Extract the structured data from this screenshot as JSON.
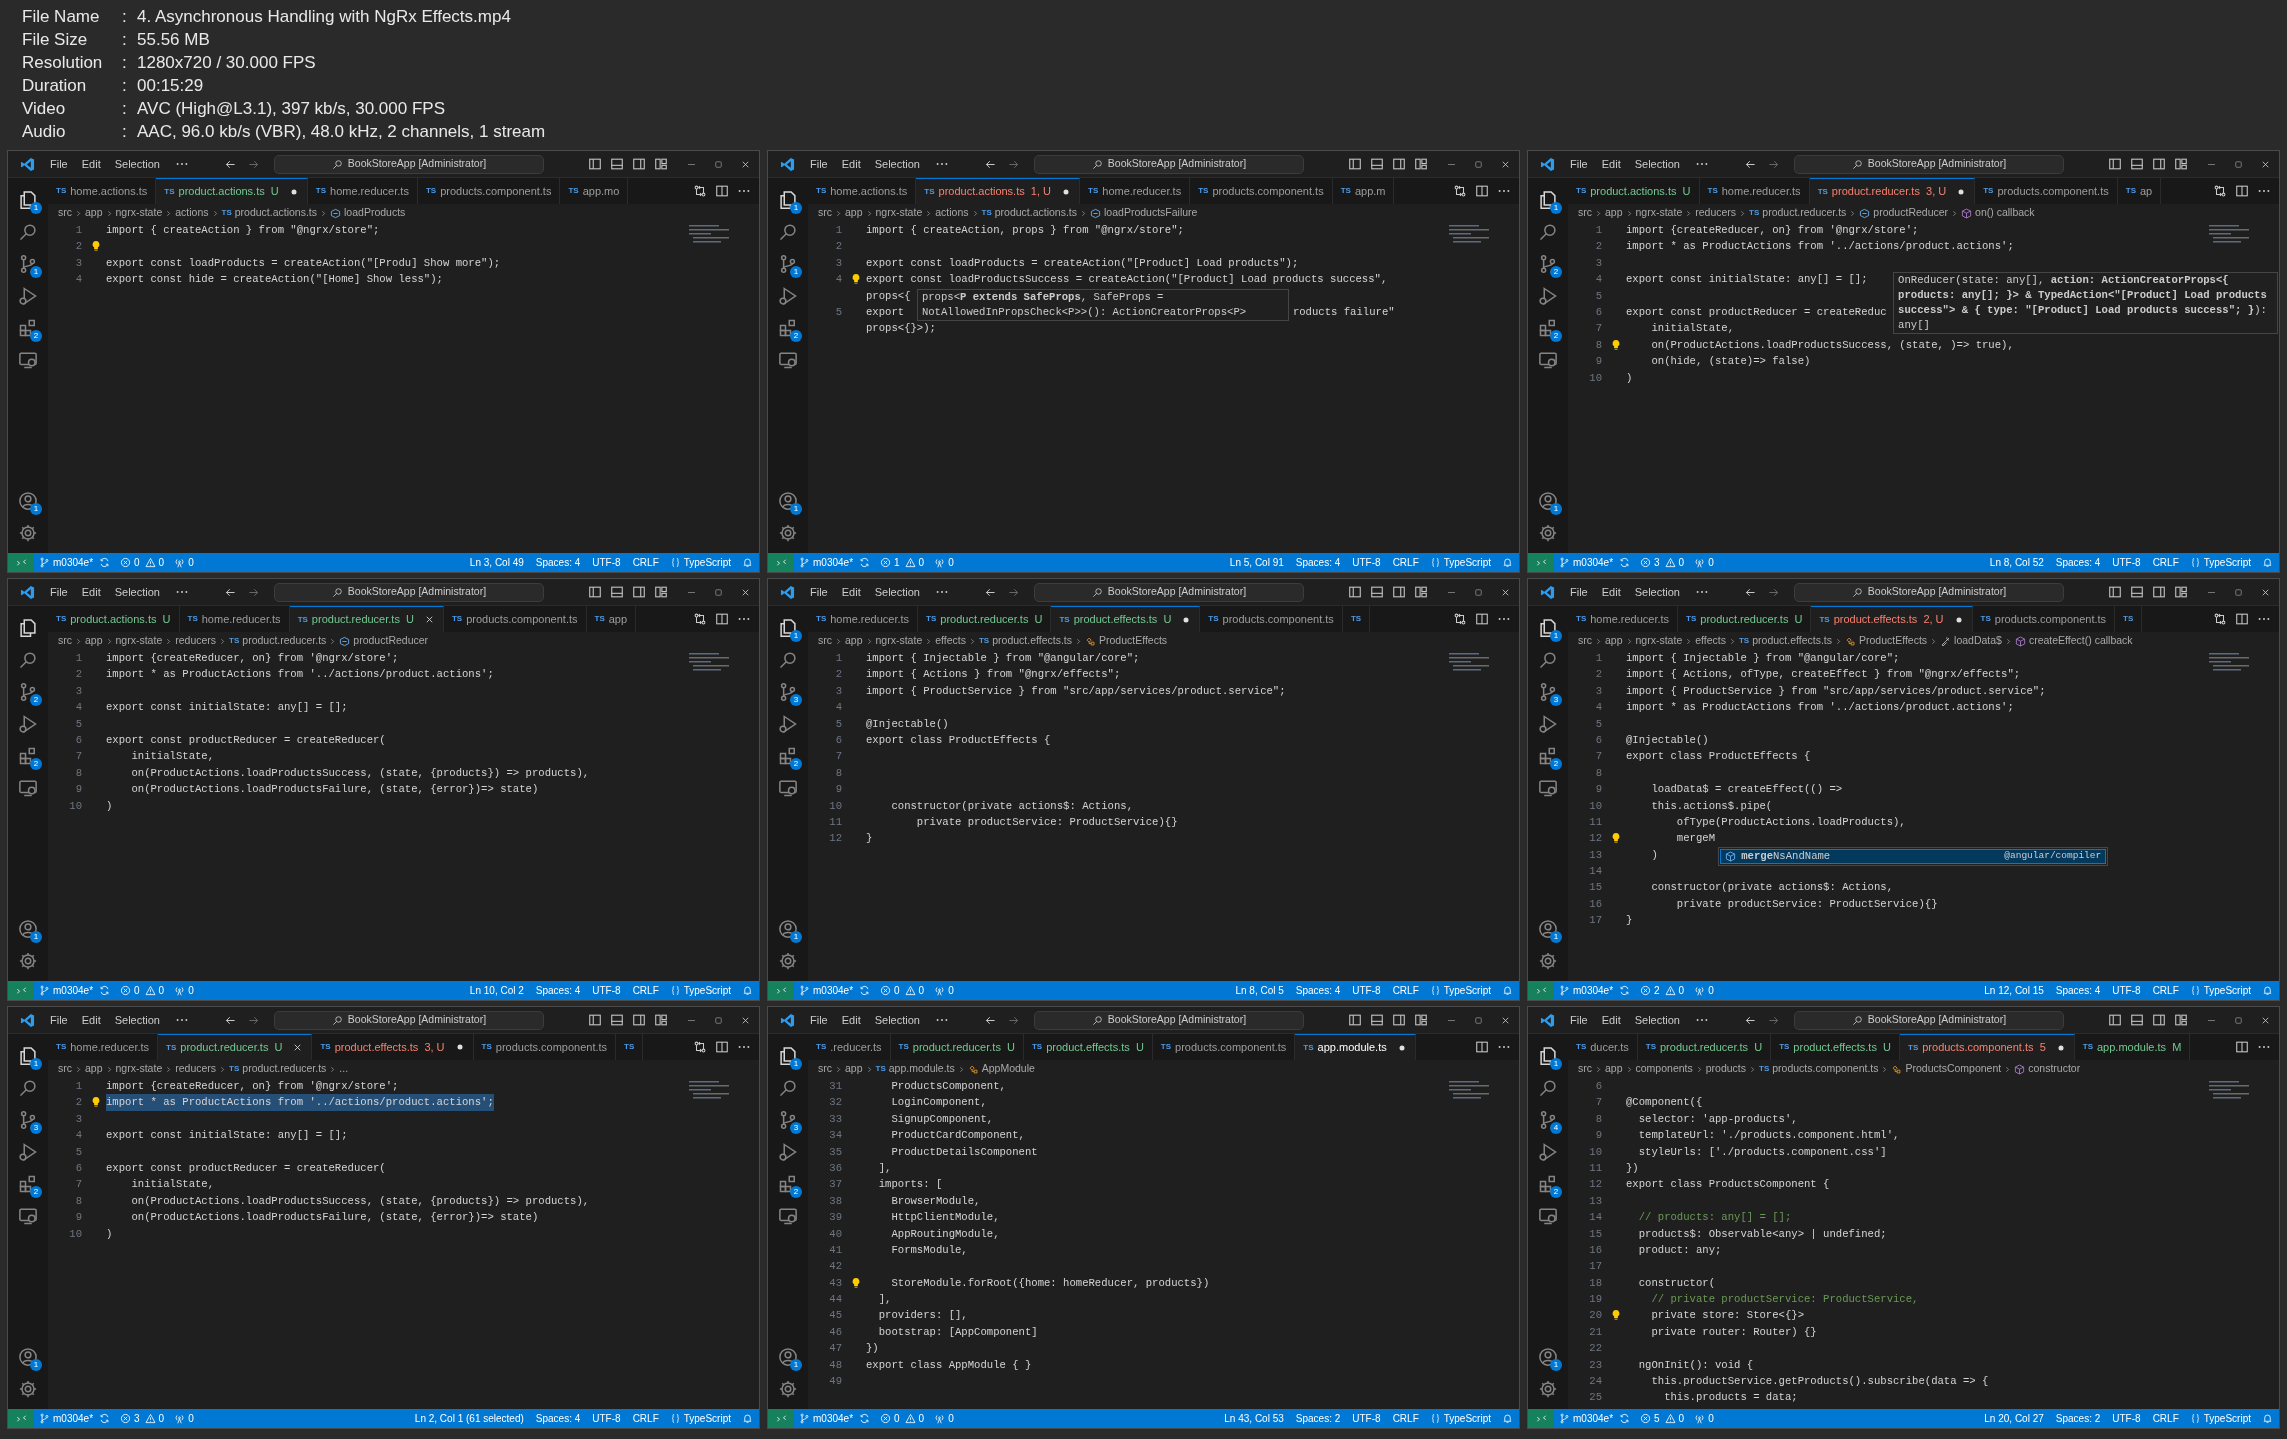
{
  "info": [
    {
      "label": "File Name",
      "colon": ":",
      "value": "4. Asynchronous Handling with NgRx Effects.mp4"
    },
    {
      "label": "File Size",
      "colon": ":",
      "value": "55.56 MB"
    },
    {
      "label": "Resolution",
      "colon": ":",
      "value": "1280x720 / 30.000 FPS"
    },
    {
      "label": "Duration",
      "colon": ":",
      "value": "00:15:29"
    },
    {
      "label": "Video",
      "colon": ":",
      "value": "AVC (High@L3.1), 397 kb/s, 30.000 FPS"
    },
    {
      "label": "Audio",
      "colon": ":",
      "value": "AAC, 96.0 kb/s (VBR), 48.0 kHz, 2 channels, 1 stream"
    }
  ],
  "panels": [
    {
      "menu": [
        "File",
        "Edit",
        "Selection"
      ],
      "title": "BookStoreApp [Administrator]",
      "badges": {
        "explorer": "1",
        "source_control": "1",
        "extensions": "2",
        "accounts": "1"
      },
      "compare_action": true,
      "tabs": [
        {
          "icon_text": "TS",
          "label": "home.actions.ts",
          "selected": false,
          "modified": false,
          "close_button": false
        },
        {
          "icon_text": "TS",
          "label": "product.actions.ts",
          "status": "U",
          "color": "#73c991",
          "selected": true,
          "modified": true,
          "close_button": false
        },
        {
          "icon_text": "TS",
          "label": "home.reducer.ts",
          "selected": false,
          "modified": false,
          "close_button": false
        },
        {
          "icon_text": "TS",
          "label": "products.component.ts",
          "selected": false,
          "modified": false,
          "close_button": false
        },
        {
          "icon_text": "TS",
          "label": "app.mo",
          "selected": false,
          "modified": false,
          "close_button": false
        }
      ],
      "breadcrumb": [
        {
          "kind": "folder",
          "label": "src"
        },
        {
          "kind": "folder",
          "label": "app"
        },
        {
          "kind": "folder",
          "label": "ngrx-state"
        },
        {
          "kind": "folder",
          "label": "actions"
        },
        {
          "kind": "file",
          "icon_text": "TS",
          "label": "product.actions.ts"
        },
        {
          "kind": "variable",
          "label": "loadProducts"
        }
      ],
      "lines": [
        {
          "n": "1",
          "text": "import { createAction } from \"@ngrx/store\";"
        },
        {
          "n": "2",
          "bulb": true
        },
        {
          "n": "3",
          "text": "export const loadProducts = createAction(\"[Produ] Show more\");"
        },
        {
          "n": "4",
          "text": "export const hide = createAction(\"[Home] Show less\");"
        }
      ],
      "status": {
        "branch": "m0304e*",
        "errors": "0",
        "warnings": "0",
        "ports": "0",
        "position": "Ln 3, Col 49",
        "indent": "Spaces: 4",
        "encoding": "UTF-8",
        "eol": "CRLF",
        "language": "TypeScript"
      }
    },
    {
      "menu": [
        "File",
        "Edit",
        "Selection"
      ],
      "title": "BookStoreApp [Administrator]",
      "badges": {
        "explorer": "1",
        "source_control": "1",
        "extensions": "2",
        "accounts": "1"
      },
      "compare_action": true,
      "tabs": [
        {
          "icon_text": "TS",
          "label": "home.actions.ts",
          "selected": false,
          "modified": false,
          "close_button": false
        },
        {
          "icon_text": "TS",
          "label": "product.actions.ts",
          "status": "1, U",
          "color": "#f88070",
          "selected": true,
          "modified": true,
          "close_button": false
        },
        {
          "icon_text": "TS",
          "label": "home.reducer.ts",
          "selected": false,
          "modified": false,
          "close_button": false
        },
        {
          "icon_text": "TS",
          "label": "products.component.ts",
          "selected": false,
          "modified": false,
          "close_button": false
        },
        {
          "icon_text": "TS",
          "label": "app.m",
          "selected": false,
          "modified": false,
          "close_button": false
        }
      ],
      "breadcrumb": [
        {
          "kind": "folder",
          "label": "src"
        },
        {
          "kind": "folder",
          "label": "app"
        },
        {
          "kind": "folder",
          "label": "ngrx-state"
        },
        {
          "kind": "folder",
          "label": "actions"
        },
        {
          "kind": "file",
          "icon_text": "TS",
          "label": "product.actions.ts"
        },
        {
          "kind": "variable",
          "label": "loadProductsFailure"
        }
      ],
      "lines": [
        {
          "n": "1",
          "text": "import { createAction, props } from \"@ngrx/store\";"
        },
        {
          "n": "2"
        },
        {
          "n": "3",
          "text": "export const loadProducts = createAction(\"[Product] Load products\");"
        },
        {
          "n": "4",
          "bulb": true,
          "text": "export const loadProductsSuccess = createAction(\"[Product] Load products success\","
        },
        {
          "text": "props<{",
          "popup": {
            "kind": "hover",
            "text": "props<**P extends SafeProps**, SafeProps = NotAllowedInPropsCheck<P>>(): ActionCreatorProps<P>"
          }
        },
        {
          "n": "5",
          "text": "export",
          "tail": "roducts failure\""
        },
        {
          "text": "props<{}>);"
        }
      ],
      "status": {
        "branch": "m0304e*",
        "errors": "1",
        "warnings": "0",
        "ports": "0",
        "position": "Ln 5, Col 91",
        "indent": "Spaces: 4",
        "encoding": "UTF-8",
        "eol": "CRLF",
        "language": "TypeScript"
      }
    },
    {
      "menu": [
        "File",
        "Edit",
        "Selection"
      ],
      "title": "BookStoreApp [Administrator]",
      "badges": {
        "explorer": "1",
        "source_control": "2",
        "extensions": "2",
        "accounts": "1"
      },
      "compare_action": true,
      "tabs": [
        {
          "icon_text": "TS",
          "label": "product.actions.ts",
          "status": "U",
          "color": "#73c991",
          "selected": false,
          "modified": false,
          "close_button": false
        },
        {
          "icon_text": "TS",
          "label": "home.reducer.ts",
          "selected": false,
          "modified": false,
          "close_button": false
        },
        {
          "icon_text": "TS",
          "label": "product.reducer.ts",
          "status": "3, U",
          "color": "#f88070",
          "selected": true,
          "modified": true,
          "close_button": false
        },
        {
          "icon_text": "TS",
          "label": "products.component.ts",
          "selected": false,
          "modified": false,
          "close_button": false
        },
        {
          "icon_text": "TS",
          "label": "ap",
          "selected": false,
          "modified": false,
          "close_button": false
        }
      ],
      "breadcrumb": [
        {
          "kind": "folder",
          "label": "src"
        },
        {
          "kind": "folder",
          "label": "app"
        },
        {
          "kind": "folder",
          "label": "ngrx-state"
        },
        {
          "kind": "folder",
          "label": "reducers"
        },
        {
          "kind": "file",
          "icon_text": "TS",
          "label": "product.reducer.ts"
        },
        {
          "kind": "variable",
          "label": "productReducer"
        },
        {
          "kind": "method",
          "label": "on() callback"
        }
      ],
      "lines": [
        {
          "n": "1",
          "text": "import {createReducer, on} from '@ngrx/store';"
        },
        {
          "n": "2",
          "text": "import * as ProductActions from '../actions/product.actions';"
        },
        {
          "n": "3"
        },
        {
          "n": "4",
          "text": "export const initialState: any[] = [];",
          "popup": {
            "kind": "hover",
            "text": "OnReducer(state: any[], **action: ActionCreatorProps<{ products: any[]; }> & TypedAction<\"[Product] Load products success\"> & { type: \"[Product] Load products success\"; }**): any[]"
          }
        },
        {
          "n": "5"
        },
        {
          "n": "6",
          "text": "export const productReducer = createReduc"
        },
        {
          "n": "7",
          "text": "    initialState,"
        },
        {
          "n": "8",
          "bulb": true,
          "text": "    on(ProductActions.loadProductsSuccess, (state, )=> true),"
        },
        {
          "n": "9",
          "text": "    on(hide, (state)=> false)"
        },
        {
          "n": "10",
          "text": ")"
        }
      ],
      "status": {
        "branch": "m0304e*",
        "errors": "3",
        "warnings": "0",
        "ports": "0",
        "position": "Ln 8, Col 52",
        "indent": "Spaces: 4",
        "encoding": "UTF-8",
        "eol": "CRLF",
        "language": "TypeScript"
      }
    },
    {
      "menu": [
        "File",
        "Edit",
        "Selection"
      ],
      "title": "BookStoreApp [Administrator]",
      "badges": {
        "source_control": "2",
        "extensions": "2",
        "accounts": "1"
      },
      "compare_action": true,
      "tabs": [
        {
          "icon_text": "TS",
          "label": "product.actions.ts",
          "status": "U",
          "color": "#73c991",
          "selected": false,
          "modified": false,
          "close_button": false
        },
        {
          "icon_text": "TS",
          "label": "home.reducer.ts",
          "selected": false,
          "modified": false,
          "close_button": false
        },
        {
          "icon_text": "TS",
          "label": "product.reducer.ts",
          "status": "U",
          "color": "#73c991",
          "selected": true,
          "modified": false,
          "close_button": true
        },
        {
          "icon_text": "TS",
          "label": "products.component.ts",
          "selected": false,
          "modified": false,
          "close_button": false
        },
        {
          "icon_text": "TS",
          "label": "app",
          "selected": false,
          "modified": false,
          "close_button": false
        }
      ],
      "breadcrumb": [
        {
          "kind": "folder",
          "label": "src"
        },
        {
          "kind": "folder",
          "label": "app"
        },
        {
          "kind": "folder",
          "label": "ngrx-state"
        },
        {
          "kind": "folder",
          "label": "reducers"
        },
        {
          "kind": "file",
          "icon_text": "TS",
          "label": "product.reducer.ts"
        },
        {
          "kind": "variable",
          "label": "productReducer"
        }
      ],
      "lines": [
        {
          "n": "1",
          "text": "import {createReducer, on} from '@ngrx/store';"
        },
        {
          "n": "2",
          "text": "import * as ProductActions from '../actions/product.actions';"
        },
        {
          "n": "3"
        },
        {
          "n": "4",
          "text": "export const initialState: any[] = [];"
        },
        {
          "n": "5"
        },
        {
          "n": "6",
          "text": "export const productReducer = createReducer("
        },
        {
          "n": "7",
          "text": "    initialState,"
        },
        {
          "n": "8",
          "text": "    on(ProductActions.loadProductsSuccess, (state, {products}) => products),"
        },
        {
          "n": "9",
          "text": "    on(ProductActions.loadProductsFailure, (state, {error})=> state)"
        },
        {
          "n": "10",
          "text": ")"
        }
      ],
      "status": {
        "branch": "m0304e*",
        "errors": "0",
        "warnings": "0",
        "ports": "0",
        "position": "Ln 10, Col 2",
        "indent": "Spaces: 4",
        "encoding": "UTF-8",
        "eol": "CRLF",
        "language": "TypeScript"
      }
    },
    {
      "menu": [
        "File",
        "Edit",
        "Selection"
      ],
      "title": "BookStoreApp [Administrator]",
      "badges": {
        "explorer": "1",
        "source_control": "3",
        "extensions": "2",
        "accounts": "1"
      },
      "compare_action": true,
      "tabs": [
        {
          "icon_text": "TS",
          "label": "home.reducer.ts",
          "selected": false,
          "modified": false,
          "close_button": false
        },
        {
          "icon_text": "TS",
          "label": "product.reducer.ts",
          "status": "U",
          "color": "#73c991",
          "selected": false,
          "modified": false,
          "close_button": false
        },
        {
          "icon_text": "TS",
          "label": "product.effects.ts",
          "status": "U",
          "color": "#73c991",
          "selected": true,
          "modified": true,
          "close_button": false
        },
        {
          "icon_text": "TS",
          "label": "products.component.ts",
          "selected": false,
          "modified": false,
          "close_button": false
        },
        {
          "icon_text": "TS",
          "selected": false,
          "modified": false,
          "close_button": false
        }
      ],
      "breadcrumb": [
        {
          "kind": "folder",
          "label": "src"
        },
        {
          "kind": "folder",
          "label": "app"
        },
        {
          "kind": "folder",
          "label": "ngrx-state"
        },
        {
          "kind": "folder",
          "label": "effects"
        },
        {
          "kind": "file",
          "icon_text": "TS",
          "label": "product.effects.ts"
        },
        {
          "kind": "class",
          "label": "ProductEffects"
        }
      ],
      "lines": [
        {
          "n": "1",
          "text": "import { Injectable } from \"@angular/core\";"
        },
        {
          "n": "2",
          "text": "import { Actions } from \"@ngrx/effects\";"
        },
        {
          "n": "3",
          "text": "import { ProductService } from \"src/app/services/product.service\";"
        },
        {
          "n": "4"
        },
        {
          "n": "5",
          "text": "@Injectable()"
        },
        {
          "n": "6",
          "text": "export class ProductEffects {"
        },
        {
          "n": "7"
        },
        {
          "n": "8"
        },
        {
          "n": "9"
        },
        {
          "n": "10",
          "text": "    constructor(private actions$: Actions,"
        },
        {
          "n": "11",
          "text": "        private productService: ProductService){}"
        },
        {
          "n": "12",
          "text": "}"
        }
      ],
      "status": {
        "branch": "m0304e*",
        "errors": "0",
        "warnings": "0",
        "ports": "0",
        "position": "Ln 8, Col 5",
        "indent": "Spaces: 4",
        "encoding": "UTF-8",
        "eol": "CRLF",
        "language": "TypeScript"
      }
    },
    {
      "menu": [
        "File",
        "Edit",
        "Selection"
      ],
      "title": "BookStoreApp [Administrator]",
      "badges": {
        "explorer": "1",
        "source_control": "3",
        "extensions": "2",
        "accounts": "1"
      },
      "compare_action": true,
      "tabs": [
        {
          "icon_text": "TS",
          "label": "home.reducer.ts",
          "selected": false,
          "modified": false,
          "close_button": false
        },
        {
          "icon_text": "TS",
          "label": "product.reducer.ts",
          "status": "U",
          "color": "#73c991",
          "selected": false,
          "modified": false,
          "close_button": false
        },
        {
          "icon_text": "TS",
          "label": "product.effects.ts",
          "status": "2, U",
          "color": "#f88070",
          "selected": true,
          "modified": true,
          "close_button": false
        },
        {
          "icon_text": "TS",
          "label": "products.component.ts",
          "selected": false,
          "modified": false,
          "close_button": false
        },
        {
          "icon_text": "TS",
          "selected": false,
          "modified": false,
          "close_button": false
        }
      ],
      "breadcrumb": [
        {
          "kind": "folder",
          "label": "src"
        },
        {
          "kind": "folder",
          "label": "app"
        },
        {
          "kind": "folder",
          "label": "ngrx-state"
        },
        {
          "kind": "folder",
          "label": "effects"
        },
        {
          "kind": "file",
          "icon_text": "TS",
          "label": "product.effects.ts"
        },
        {
          "kind": "class",
          "label": "ProductEffects"
        },
        {
          "kind": "property",
          "label": "loadData$"
        },
        {
          "kind": "method",
          "label": "createEffect() callback"
        }
      ],
      "lines": [
        {
          "n": "1",
          "text": "import { Injectable } from \"@angular/core\";"
        },
        {
          "n": "2",
          "text": "import { Actions, ofType, createEffect } from \"@ngrx/effects\";"
        },
        {
          "n": "3",
          "text": "import { ProductService } from \"src/app/services/product.service\";"
        },
        {
          "n": "4",
          "text": "import * as ProductActions from '../actions/product.actions';"
        },
        {
          "n": "5"
        },
        {
          "n": "6",
          "text": "@Injectable()"
        },
        {
          "n": "7",
          "text": "export class ProductEffects {"
        },
        {
          "n": "8"
        },
        {
          "n": "9",
          "text": "    loadData$ = createEffect(() =>"
        },
        {
          "n": "10",
          "text": "    this.actions$.pipe("
        },
        {
          "n": "11",
          "text": "        ofType(ProductActions.loadProducts),"
        },
        {
          "n": "12",
          "bulb": true,
          "text": "        mergeM",
          "popup": {
            "kind": "suggest",
            "text": "**merge**NsAndName",
            "detail": "@angular/compiler"
          }
        },
        {
          "n": "13",
          "text": "    )"
        },
        {
          "n": "14"
        },
        {
          "n": "15",
          "text": "    constructor(private actions$: Actions,"
        },
        {
          "n": "16",
          "text": "        private productService: ProductService){}"
        },
        {
          "n": "17",
          "text": "}"
        }
      ],
      "status": {
        "branch": "m0304e*",
        "errors": "2",
        "warnings": "0",
        "ports": "0",
        "position": "Ln 12, Col 15",
        "indent": "Spaces: 4",
        "encoding": "UTF-8",
        "eol": "CRLF",
        "language": "TypeScript"
      }
    },
    {
      "menu": [
        "File",
        "Edit",
        "Selection"
      ],
      "title": "BookStoreApp [Administrator]",
      "badges": {
        "explorer": "1",
        "source_control": "3",
        "extensions": "2",
        "accounts": "1"
      },
      "compare_action": true,
      "tabs": [
        {
          "icon_text": "TS",
          "label": "home.reducer.ts",
          "selected": false,
          "modified": false,
          "close_button": false
        },
        {
          "icon_text": "TS",
          "label": "product.reducer.ts",
          "status": "U",
          "color": "#73c991",
          "selected": true,
          "modified": false,
          "close_button": true
        },
        {
          "icon_text": "TS",
          "label": "product.effects.ts",
          "status": "3, U",
          "color": "#f88070",
          "selected": false,
          "modified": true,
          "close_button": false
        },
        {
          "icon_text": "TS",
          "label": "products.component.ts",
          "selected": false,
          "modified": false,
          "close_button": false
        },
        {
          "icon_text": "TS",
          "selected": false,
          "modified": false,
          "close_button": false
        }
      ],
      "breadcrumb": [
        {
          "kind": "folder",
          "label": "src"
        },
        {
          "kind": "folder",
          "label": "app"
        },
        {
          "kind": "folder",
          "label": "ngrx-state"
        },
        {
          "kind": "folder",
          "label": "reducers"
        },
        {
          "kind": "file",
          "icon_text": "TS",
          "label": "product.reducer.ts"
        },
        {
          "kind": "more",
          "label": "..."
        }
      ],
      "lines": [
        {
          "n": "1",
          "text": "import {createReducer, on} from '@ngrx/store';"
        },
        {
          "n": "2",
          "bulb": true,
          "selected": true,
          "text": "import * as ProductActions from '../actions/product.actions';"
        },
        {
          "n": "3"
        },
        {
          "n": "4",
          "text": "export const initialState: any[] = [];"
        },
        {
          "n": "5"
        },
        {
          "n": "6",
          "text": "export const productReducer = createReducer("
        },
        {
          "n": "7",
          "text": "    initialState,"
        },
        {
          "n": "8",
          "text": "    on(ProductActions.loadProductsSuccess, (state, {products}) => products),"
        },
        {
          "n": "9",
          "text": "    on(ProductActions.loadProductsFailure, (state, {error})=> state)"
        },
        {
          "n": "10",
          "text": ")"
        }
      ],
      "status": {
        "branch": "m0304e*",
        "errors": "3",
        "warnings": "0",
        "ports": "0",
        "position": "Ln 2, Col 1 (61 selected)",
        "indent": "Spaces: 4",
        "encoding": "UTF-8",
        "eol": "CRLF",
        "language": "TypeScript"
      }
    },
    {
      "menu": [
        "File",
        "Edit",
        "Selection"
      ],
      "title": "BookStoreApp [Administrator]",
      "badges": {
        "explorer": "1",
        "source_control": "3",
        "extensions": "2",
        "accounts": "1"
      },
      "compare_action": false,
      "tabs": [
        {
          "icon_text": "TS",
          "label": ".reducer.ts",
          "selected": false,
          "modified": false,
          "close_button": false
        },
        {
          "icon_text": "TS",
          "label": "product.reducer.ts",
          "status": "U",
          "color": "#73c991",
          "selected": false,
          "modified": false,
          "close_button": false
        },
        {
          "icon_text": "TS",
          "label": "product.effects.ts",
          "status": "U",
          "color": "#73c991",
          "selected": false,
          "modified": false,
          "close_button": false
        },
        {
          "icon_text": "TS",
          "label": "products.component.ts",
          "selected": false,
          "modified": false,
          "close_button": false
        },
        {
          "icon_text": "TS",
          "label": "app.module.ts",
          "selected": true,
          "modified": true,
          "close_button": false
        }
      ],
      "breadcrumb": [
        {
          "kind": "folder",
          "label": "src"
        },
        {
          "kind": "folder",
          "label": "app"
        },
        {
          "kind": "file",
          "icon_text": "TS",
          "label": "app.module.ts"
        },
        {
          "kind": "class",
          "label": "AppModule"
        }
      ],
      "lines": [
        {
          "n": "31",
          "text": "    ProductsComponent,"
        },
        {
          "n": "32",
          "text": "    LoginComponent,"
        },
        {
          "n": "33",
          "text": "    SignupComponent,"
        },
        {
          "n": "34",
          "text": "    ProductCardComponent,"
        },
        {
          "n": "35",
          "text": "    ProductDetailsComponent"
        },
        {
          "n": "36",
          "text": "  ],"
        },
        {
          "n": "37",
          "text": "  imports: ["
        },
        {
          "n": "38",
          "text": "    BrowserModule,"
        },
        {
          "n": "39",
          "text": "    HttpClientModule,"
        },
        {
          "n": "40",
          "text": "    AppRoutingModule,"
        },
        {
          "n": "41",
          "text": "    FormsModule,"
        },
        {
          "n": "42"
        },
        {
          "n": "43",
          "bulb": true,
          "text": "    StoreModule.forRoot({home: homeReducer, products})"
        },
        {
          "n": "44",
          "text": "  ],"
        },
        {
          "n": "45",
          "text": "  providers: [],"
        },
        {
          "n": "46",
          "text": "  bootstrap: [AppComponent]"
        },
        {
          "n": "47",
          "text": "})"
        },
        {
          "n": "48",
          "text": "export class AppModule { }"
        },
        {
          "n": "49"
        }
      ],
      "status": {
        "branch": "m0304e*",
        "errors": "0",
        "warnings": "0",
        "ports": "0",
        "position": "Ln 43, Col 53",
        "indent": "Spaces: 2",
        "encoding": "UTF-8",
        "eol": "CRLF",
        "language": "TypeScript"
      }
    },
    {
      "menu": [
        "File",
        "Edit",
        "Selection"
      ],
      "title": "BookStoreApp [Administrator]",
      "badges": {
        "explorer": "1",
        "source_control": "4",
        "extensions": "2",
        "accounts": "1"
      },
      "compare_action": false,
      "tabs": [
        {
          "icon_text": "TS",
          "label": "ducer.ts",
          "selected": false,
          "modified": false,
          "close_button": false
        },
        {
          "icon_text": "TS",
          "label": "product.reducer.ts",
          "status": "U",
          "color": "#73c991",
          "selected": false,
          "modified": false,
          "close_button": false
        },
        {
          "icon_text": "TS",
          "label": "product.effects.ts",
          "status": "U",
          "color": "#73c991",
          "selected": false,
          "modified": false,
          "close_button": false
        },
        {
          "icon_text": "TS",
          "label": "products.component.ts",
          "status": "5",
          "color": "#f88070",
          "selected": true,
          "modified": true,
          "close_button": false
        },
        {
          "icon_text": "TS",
          "label": "app.module.ts",
          "status": "M",
          "color": "#73c991",
          "selected": false,
          "modified": false,
          "close_button": false
        }
      ],
      "breadcrumb": [
        {
          "kind": "folder",
          "label": "src"
        },
        {
          "kind": "folder",
          "label": "app"
        },
        {
          "kind": "folder",
          "label": "components"
        },
        {
          "kind": "folder",
          "label": "products"
        },
        {
          "kind": "file",
          "icon_text": "TS",
          "label": "products.component.ts"
        },
        {
          "kind": "class",
          "label": "ProductsComponent"
        },
        {
          "kind": "method",
          "label": "constructor"
        }
      ],
      "lines": [
        {
          "n": "6"
        },
        {
          "n": "7",
          "text": "@Component({"
        },
        {
          "n": "8",
          "text": "  selector: 'app-products',"
        },
        {
          "n": "9",
          "text": "  templateUrl: './products.component.html',"
        },
        {
          "n": "10",
          "text": "  styleUrls: ['./products.component.css']"
        },
        {
          "n": "11",
          "text": "})"
        },
        {
          "n": "12",
          "text": "export class ProductsComponent {"
        },
        {
          "n": "13"
        },
        {
          "n": "14",
          "kind": "comment",
          "text": "  // products: any[] = [];"
        },
        {
          "n": "15",
          "text": "  products$: Observable<any> | undefined;"
        },
        {
          "n": "16",
          "text": "  product: any;"
        },
        {
          "n": "17"
        },
        {
          "n": "18",
          "text": "  constructor("
        },
        {
          "n": "19",
          "kind": "comment",
          "text": "    // private productService: ProductService,"
        },
        {
          "n": "20",
          "bulb": true,
          "text": "    private store: Store<{}>"
        },
        {
          "n": "21",
          "text": "    private router: Router) {}"
        },
        {
          "n": "22"
        },
        {
          "n": "23",
          "text": "  ngOnInit(): void {"
        },
        {
          "n": "24",
          "text": "    this.productService.getProducts().subscribe(data => {"
        },
        {
          "n": "25",
          "text": "      this.products = data;"
        }
      ],
      "status": {
        "branch": "m0304e*",
        "errors": "5",
        "warnings": "0",
        "ports": "0",
        "position": "Ln 20, Col 27",
        "indent": "Spaces: 2",
        "encoding": "UTF-8",
        "eol": "CRLF",
        "language": "TypeScript"
      }
    }
  ]
}
